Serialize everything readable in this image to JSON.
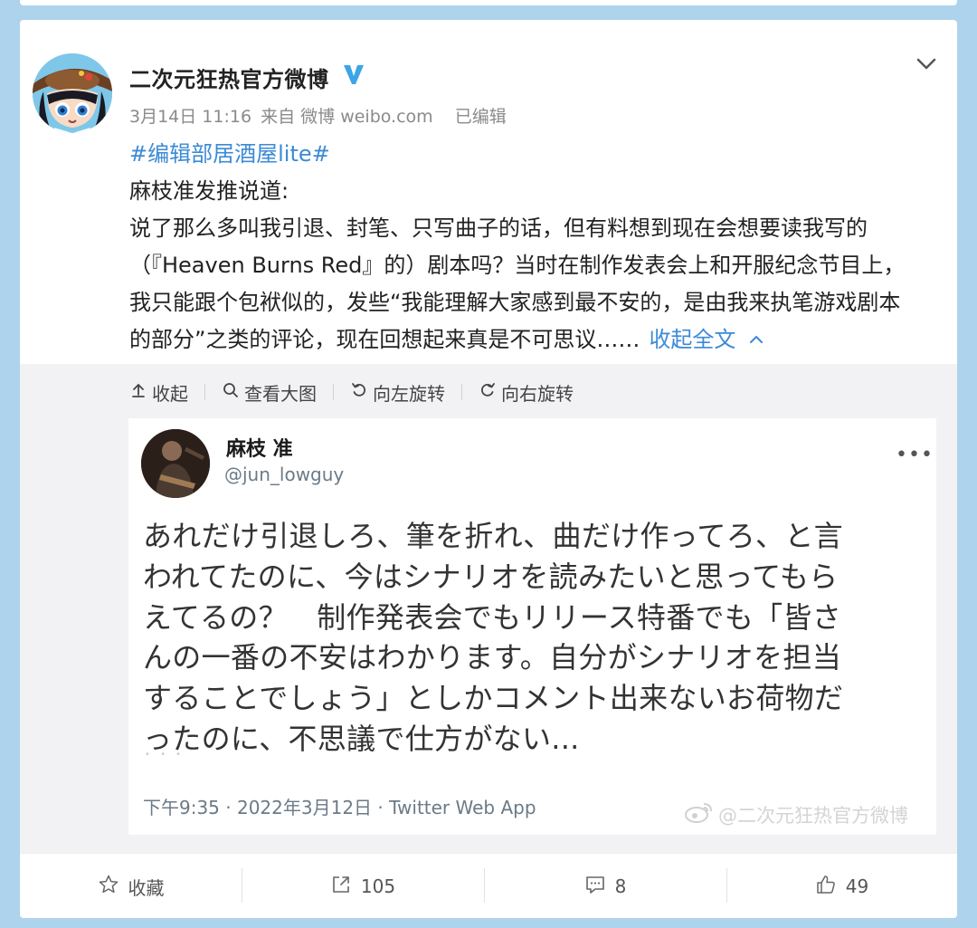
{
  "post": {
    "author": "二次元狂热官方微博",
    "date": "3月14日 11:16",
    "source": "来自 微博 weibo.com",
    "edited": "已编辑",
    "hashtag": "#编辑部居酒屋lite#",
    "lines": [
      "麻枝准发推说道:",
      "说了那么多叫我引退、封笔、只写曲子的话，但有料想到现在会想要读我写的",
      "（『Heaven Burns Red』的）剧本吗？当时在制作发表会上和开服纪念节目上，",
      "我只能跟个包袱似的，发些“我能理解大家感到最不安的，是由我来执笔游戏剧本",
      "的部分”之类的评论，现在回想起来真是不可思议……"
    ],
    "collapse_label": "收起全文"
  },
  "media_toolbar": {
    "collapse": "收起",
    "view_large": "查看大图",
    "rotate_left": "向左旋转",
    "rotate_right": "向右旋转"
  },
  "tweet": {
    "name": "麻枝 准",
    "handle": "@jun_lowguy",
    "more": "•••",
    "lines": [
      "あれだけ引退しろ、筆を折れ、曲だけ作ってろ、と言",
      "われてたのに、今はシナリオを読みたいと思ってもら",
      "えてるの？　制作発表会でもリリース特番でも「皆さ",
      "んの一番の不安はわかります。自分がシナリオを担当",
      "することでしょう」としかコメント出来ないお荷物だ",
      "ったのに、不思議で仕方がない..."
    ],
    "footer": "下午9:35 · 2022年3月12日 · Twitter Web App",
    "watermark": "@二次元狂热官方微博"
  },
  "actions": {
    "favorite": "收藏",
    "repost_count": "105",
    "comment_count": "8",
    "like_count": "49"
  },
  "colors": {
    "background": "#aed3ec",
    "link": "#3c8ad6",
    "verified": "#3ba5e6",
    "meta": "#8a8a8a"
  },
  "icons": [
    "verified-icon",
    "chevron-down-icon",
    "chevron-up-icon",
    "upload-icon",
    "search-icon",
    "rotate-left-icon",
    "rotate-right-icon",
    "more-icon",
    "weibo-icon",
    "star-icon",
    "repost-icon",
    "comment-icon",
    "like-icon"
  ]
}
